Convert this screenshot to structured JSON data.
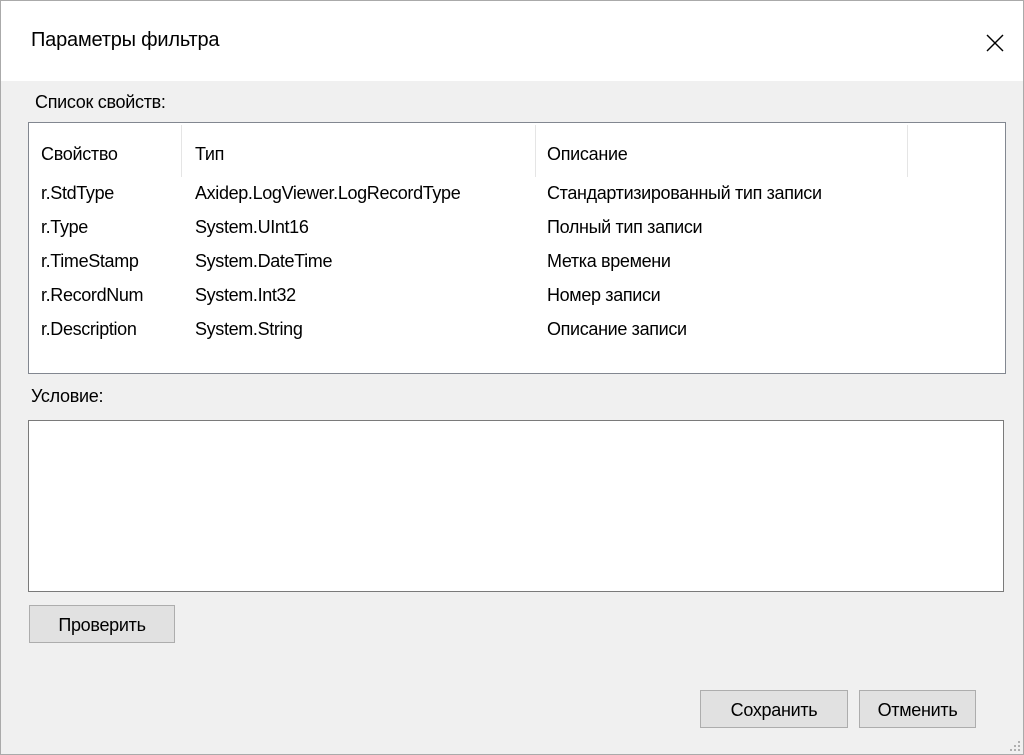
{
  "window": {
    "title": "Параметры фильтра"
  },
  "properties": {
    "label": "Список свойств:",
    "columns": [
      "Свойство",
      "Тип",
      "Описание"
    ],
    "rows": [
      [
        "r.StdType",
        "Axidep.LogViewer.LogRecordType",
        "Стандартизированный тип записи"
      ],
      [
        "r.Type",
        "System.UInt16",
        "Полный тип записи"
      ],
      [
        "r.TimeStamp",
        "System.DateTime",
        "Метка времени"
      ],
      [
        "r.RecordNum",
        "System.Int32",
        "Номер записи"
      ],
      [
        "r.Description",
        "System.String",
        "Описание записи"
      ]
    ]
  },
  "condition": {
    "label": "Условие:",
    "value": ""
  },
  "buttons": {
    "check": "Проверить",
    "save": "Сохранить",
    "cancel": "Отменить"
  },
  "icons": {
    "close": "close-icon",
    "resize": "resize-grip-icon"
  }
}
